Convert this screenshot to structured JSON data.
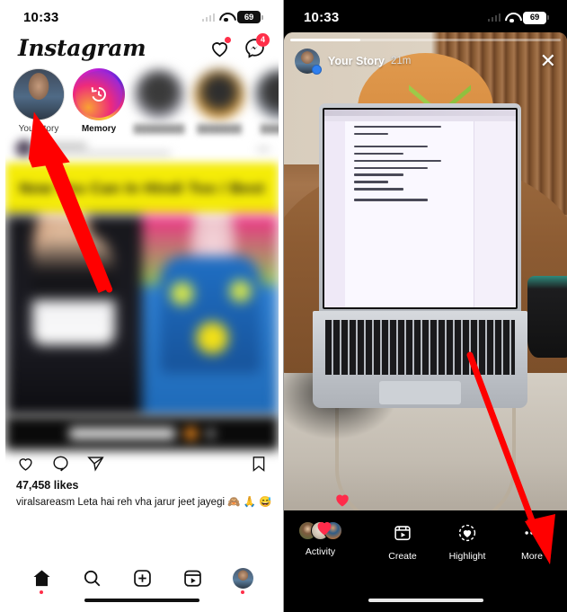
{
  "left": {
    "status": {
      "time": "10:33",
      "battery": "69",
      "wifi_icon": "wifi-icon",
      "signal_icon": "signal-icon"
    },
    "header": {
      "logo": "Instagram",
      "heart_icon": "heart-icon",
      "messenger_icon": "messenger-icon",
      "messenger_badge": "4"
    },
    "stories": [
      {
        "label": "Your story",
        "type": "self"
      },
      {
        "label": "Memory",
        "type": "memory"
      },
      {
        "label": "",
        "type": "blurred"
      },
      {
        "label": "",
        "type": "blurred"
      },
      {
        "label": "",
        "type": "blurred"
      }
    ],
    "post": {
      "banner_text": "Now You Can In Hindi Too / Best",
      "likes": "47,458 likes",
      "caption": "viralsareasm Leta hai reh vha jarur jeet jayegi 🙈 🙏 😅",
      "like_icon": "heart-icon",
      "comment_icon": "comment-icon",
      "share_icon": "share-icon",
      "save_icon": "bookmark-icon"
    },
    "nav": [
      {
        "name": "home",
        "icon": "home-icon",
        "active": true
      },
      {
        "name": "search",
        "icon": "search-icon",
        "active": false
      },
      {
        "name": "create",
        "icon": "plus-square-icon",
        "active": false
      },
      {
        "name": "reels",
        "icon": "reels-icon",
        "active": false
      },
      {
        "name": "profile",
        "icon": "avatar-icon",
        "active": false
      }
    ]
  },
  "right": {
    "status": {
      "time": "10:33",
      "battery": "69",
      "wifi_icon": "wifi-icon",
      "signal_icon": "signal-icon"
    },
    "story_header": {
      "author": "Your Story",
      "time": "21m",
      "close_icon": "close-icon",
      "verified_icon": "story-badge-icon",
      "progress_percent": 26
    },
    "reactions": [
      {
        "icon": "heart-reaction-icon"
      },
      {
        "icon": "heart-reaction-icon"
      }
    ],
    "bottom": {
      "activity_label": "Activity",
      "actions": [
        {
          "label": "Create",
          "icon": "create-reel-icon"
        },
        {
          "label": "Highlight",
          "icon": "highlight-heart-icon"
        },
        {
          "label": "More",
          "icon": "more-dots-icon"
        }
      ]
    }
  },
  "annotations": {
    "arrow_color": "#ff0000",
    "arrows": [
      {
        "name": "arrow-to-your-story",
        "target": "Your story"
      },
      {
        "name": "arrow-to-more",
        "target": "More"
      }
    ]
  }
}
